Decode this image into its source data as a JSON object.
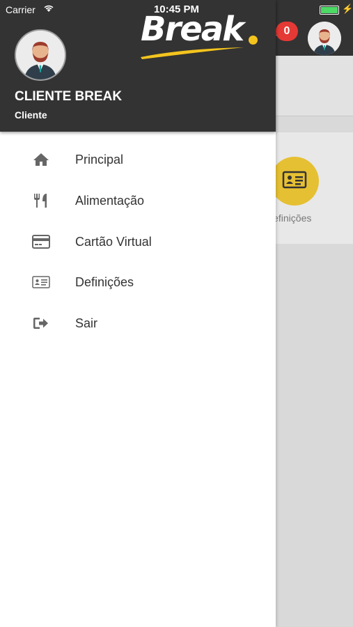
{
  "status_bar": {
    "carrier": "Carrier",
    "time": "10:45 PM"
  },
  "brand": {
    "logo_text": "Break",
    "accent_color": "#f4c41e",
    "header_color": "#333333"
  },
  "header": {
    "notification_count": "0"
  },
  "profile": {
    "name": "CLIENTE BREAK",
    "role": "Cliente"
  },
  "menu": [
    {
      "label": "Principal",
      "icon": "home-icon"
    },
    {
      "label": "Alimentação",
      "icon": "utensils-icon"
    },
    {
      "label": "Cartão Virtual",
      "icon": "credit-card-icon"
    },
    {
      "label": "Definições",
      "icon": "id-card-icon"
    },
    {
      "label": "Sair",
      "icon": "sign-out-icon"
    }
  ],
  "background_view": {
    "card_label": "Definições"
  }
}
